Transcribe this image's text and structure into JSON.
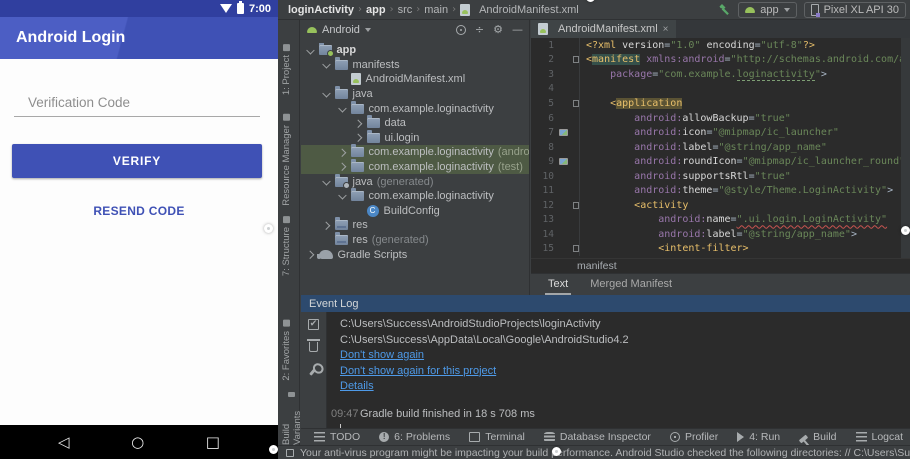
{
  "colors": {
    "accent_indigo": "#3F51B5",
    "android_green": "#97C15C",
    "link_blue": "#4E9AE8",
    "tree_selection_green": "#4E5A44",
    "eventlog_header_blue": "#2D4A6E"
  },
  "emulator": {
    "status_bar": {
      "time": "7:00"
    },
    "app_bar": {
      "title": "Android Login"
    },
    "form": {
      "input_placeholder": "Verification Code",
      "verify_button": "VERIFY",
      "resend_link": "RESEND CODE"
    }
  },
  "ide": {
    "breadcrumb": [
      {
        "t": "loginActivity",
        "strong": true
      },
      {
        "t": "app",
        "strong": true
      },
      {
        "t": "src"
      },
      {
        "t": "main"
      },
      {
        "t": "AndroidManifest.xml",
        "icon": "manifest"
      }
    ],
    "run_toolbar": {
      "config_label": "app",
      "device_label": "Pixel XL API 30"
    },
    "tool_strip_left": [
      {
        "label": "1: Project",
        "icon": "project-icon"
      },
      {
        "label": "Resource Manager",
        "icon": "resource-manager-icon"
      },
      {
        "label": "7: Structure",
        "icon": "structure-icon"
      },
      {
        "label": "2: Favorites",
        "icon": "favorites-icon"
      },
      {
        "label": "Build Variants",
        "icon": "build-variants-icon"
      }
    ],
    "project_panel": {
      "view_selector": "Android",
      "tree": [
        {
          "d": 0,
          "a": "v",
          "i": "module",
          "t": "app",
          "b": 1
        },
        {
          "d": 1,
          "a": "v",
          "i": "folder",
          "t": "manifests"
        },
        {
          "d": 2,
          "i": "manifest",
          "t": "AndroidManifest.xml"
        },
        {
          "d": 1,
          "a": "v",
          "i": "folder",
          "t": "java"
        },
        {
          "d": 2,
          "a": "v",
          "i": "package",
          "t": "com.example.loginactivity"
        },
        {
          "d": 3,
          "a": "r",
          "i": "package",
          "t": "data"
        },
        {
          "d": 3,
          "a": "r",
          "i": "package",
          "t": "ui.login"
        },
        {
          "d": 2,
          "a": "r",
          "i": "package",
          "t": "com.example.loginactivity",
          "x": "(androidTest)",
          "sel": 1
        },
        {
          "d": 2,
          "a": "r",
          "i": "package",
          "t": "com.example.loginactivity",
          "x": "(test)",
          "sel": 1
        },
        {
          "d": 1,
          "a": "v",
          "i": "foldergen",
          "t": "java",
          "x": "(generated)"
        },
        {
          "d": 2,
          "a": "v",
          "i": "package",
          "t": "com.example.loginactivity"
        },
        {
          "d": 3,
          "i": "buildconfig",
          "t": "BuildConfig"
        },
        {
          "d": 1,
          "a": "r",
          "i": "resfolder",
          "t": "res"
        },
        {
          "d": 1,
          "i": "resfolder",
          "t": "res",
          "x": "(generated)"
        },
        {
          "d": 0,
          "a": "r",
          "i": "gradle",
          "t": "Gradle Scripts"
        }
      ]
    },
    "editor": {
      "tab_title": "AndroidManifest.xml",
      "breadcrumb": "manifest",
      "bottom_tabs": [
        {
          "t": "Text",
          "active": true
        },
        {
          "t": "Merged Manifest"
        }
      ],
      "lines": [
        {
          "n": 1,
          "s": [
            [
              "<?xml ",
              "t"
            ],
            [
              "version",
              "a"
            ],
            [
              "=",
              "p"
            ],
            [
              "\"1.0\"",
              "v"
            ],
            [
              " ",
              "p"
            ],
            [
              "encoding",
              "a"
            ],
            [
              "=",
              "p"
            ],
            [
              "\"utf-8\"",
              "v"
            ],
            [
              "?>",
              "t"
            ]
          ]
        },
        {
          "n": 2,
          "f": 1,
          "s": [
            [
              "<",
              "t"
            ],
            [
              "manifest",
              "t hm"
            ],
            [
              " ",
              "p"
            ],
            [
              "xmlns:android",
              "n"
            ],
            [
              "=",
              "p"
            ],
            [
              "\"http://schemas.android.com/apk/res/android\"",
              "v"
            ]
          ]
        },
        {
          "n": 3,
          "s": [
            [
              "    ",
              "p"
            ],
            [
              "package",
              "n"
            ],
            [
              "=",
              "p"
            ],
            [
              "\"com.example.",
              "v"
            ],
            [
              "loginactivity",
              "vu"
            ],
            [
              "\"",
              "v"
            ],
            [
              ">",
              "p"
            ]
          ]
        },
        {
          "n": 4,
          "s": []
        },
        {
          "n": 5,
          "f": 1,
          "s": [
            [
              "    ",
              "p"
            ],
            [
              "<",
              "t"
            ],
            [
              "application",
              "t ha"
            ]
          ]
        },
        {
          "n": 6,
          "s": [
            [
              "        ",
              "p"
            ],
            [
              "android:",
              "n"
            ],
            [
              "allowBackup",
              "a"
            ],
            [
              "=",
              "p"
            ],
            [
              "\"true\"",
              "v"
            ]
          ]
        },
        {
          "n": 7,
          "ic": 1,
          "s": [
            [
              "        ",
              "p"
            ],
            [
              "android:",
              "n"
            ],
            [
              "icon",
              "a"
            ],
            [
              "=",
              "p"
            ],
            [
              "\"@mipmap/ic_launcher\"",
              "v"
            ]
          ]
        },
        {
          "n": 8,
          "s": [
            [
              "        ",
              "p"
            ],
            [
              "android:",
              "n"
            ],
            [
              "label",
              "a"
            ],
            [
              "=",
              "p"
            ],
            [
              "\"@string/app_name\"",
              "v"
            ]
          ]
        },
        {
          "n": 9,
          "ic": 1,
          "s": [
            [
              "        ",
              "p"
            ],
            [
              "android:",
              "n"
            ],
            [
              "roundIcon",
              "a"
            ],
            [
              "=",
              "p"
            ],
            [
              "\"@mipmap/ic_launcher_round\"",
              "v"
            ]
          ]
        },
        {
          "n": 10,
          "s": [
            [
              "        ",
              "p"
            ],
            [
              "android:",
              "n"
            ],
            [
              "supportsRtl",
              "a"
            ],
            [
              "=",
              "p"
            ],
            [
              "\"true\"",
              "v"
            ]
          ]
        },
        {
          "n": 11,
          "s": [
            [
              "        ",
              "p"
            ],
            [
              "android:",
              "n"
            ],
            [
              "theme",
              "a"
            ],
            [
              "=",
              "p"
            ],
            [
              "\"@style/Theme.LoginActivity\"",
              "v"
            ],
            [
              ">",
              "p"
            ]
          ]
        },
        {
          "n": 12,
          "f": 1,
          "s": [
            [
              "        ",
              "p"
            ],
            [
              "<activity",
              "t"
            ]
          ]
        },
        {
          "n": 13,
          "s": [
            [
              "            ",
              "p"
            ],
            [
              "android:",
              "n"
            ],
            [
              "name",
              "a"
            ],
            [
              "=",
              "p"
            ],
            [
              "\".ui.login.LoginActivity\"",
              "ve"
            ]
          ]
        },
        {
          "n": 14,
          "s": [
            [
              "            ",
              "p"
            ],
            [
              "android:",
              "n"
            ],
            [
              "label",
              "a"
            ],
            [
              "=",
              "p"
            ],
            [
              "\"@string/app_name\"",
              "v"
            ],
            [
              ">",
              "p"
            ]
          ]
        },
        {
          "n": 15,
          "f": 1,
          "s": [
            [
              "            ",
              "p"
            ],
            [
              "<intent-filter>",
              "t"
            ]
          ]
        }
      ]
    },
    "event_log": {
      "title": "Event Log",
      "paths": [
        "C:\\Users\\Success\\AndroidStudioProjects\\loginActivity",
        "C:\\Users\\Success\\AppData\\Local\\Google\\AndroidStudio4.2"
      ],
      "links": [
        "Don't show again",
        "Don't show again for this project",
        "Details"
      ],
      "entry": {
        "time": "09:47",
        "text": "Gradle build finished in 18 s 708 ms"
      }
    },
    "bottom_bar": [
      {
        "t": "TODO",
        "i": "list"
      },
      {
        "t": "6: Problems",
        "i": "problem"
      },
      {
        "t": "Terminal",
        "i": "terminal"
      },
      {
        "t": "Database Inspector",
        "i": "db"
      },
      {
        "t": "Profiler",
        "i": "profiler"
      },
      {
        "t": "4: Run",
        "i": "run"
      },
      {
        "t": "Build",
        "i": "build"
      },
      {
        "t": "Logcat",
        "i": "logcat"
      }
    ],
    "status_bar": {
      "message": "Your anti-virus program might be impacting your build performance. Android Studio checked the following directories: // C:\\Users\\Success\\.gradle // C"
    }
  }
}
